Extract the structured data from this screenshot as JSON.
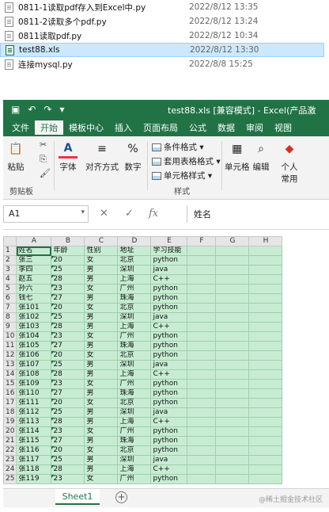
{
  "explorer": {
    "files": [
      {
        "name": "0811-1读取pdf存入到Excel中.py",
        "date": "2022/8/12 13:35",
        "icon": "py-file-icon",
        "selected": false
      },
      {
        "name": "0811-2读取多个pdf.py",
        "date": "2022/8/12 13:24",
        "icon": "py-file-icon",
        "selected": false
      },
      {
        "name": "0811读取pdf.py",
        "date": "2022/8/12 10:34",
        "icon": "py-file-icon",
        "selected": false
      },
      {
        "name": "test88.xls",
        "date": "2022/8/12 13:30",
        "icon": "xls-file-icon",
        "selected": true
      },
      {
        "name": "连接mysql.py",
        "date": "2022/8/8 15:25",
        "icon": "py-file-icon",
        "selected": false
      }
    ]
  },
  "excel": {
    "title": "test88.xls [兼容模式] - Excel(产品激",
    "colors": {
      "accent": "#217346",
      "cell_fill": "#c7ecd3"
    },
    "tabs": [
      "文件",
      "开始",
      "模板中心",
      "插入",
      "页面布局",
      "公式",
      "数据",
      "审阅",
      "视图"
    ],
    "active_tab": "开始",
    "ribbon": {
      "paste": "粘贴",
      "clipboard_group": "剪贴板",
      "font": "字体",
      "alignment": "对齐方式",
      "number": "数字",
      "conditional_format": "条件格式",
      "table_format": "套用表格格式",
      "cell_style": "单元格样式",
      "styles_group": "样式",
      "cells": "单元格",
      "editing": "编辑",
      "personal": "个人",
      "common": "常用",
      "number_symbol": "%",
      "font_symbol": "A"
    },
    "formula_bar": {
      "cell_ref": "A1",
      "fx": "fx",
      "cancel": "✕",
      "confirm": "✓",
      "content": "姓名"
    },
    "columns": [
      "A",
      "B",
      "C",
      "D",
      "E",
      "F",
      "G",
      "H"
    ],
    "header_row": [
      "姓名",
      "年龄",
      "性别",
      "地址",
      "学习技能"
    ],
    "rows": [
      [
        "张三",
        "20",
        "女",
        "北京",
        "python"
      ],
      [
        "李四",
        "25",
        "男",
        "深圳",
        "java"
      ],
      [
        "赵五",
        "28",
        "男",
        "上海",
        "C++"
      ],
      [
        "孙六",
        "23",
        "女",
        "广州",
        "python"
      ],
      [
        "钱七",
        "27",
        "男",
        "珠海",
        "python"
      ],
      [
        "张101",
        "20",
        "女",
        "北京",
        "python"
      ],
      [
        "张102",
        "25",
        "男",
        "深圳",
        "java"
      ],
      [
        "张103",
        "28",
        "男",
        "上海",
        "C++"
      ],
      [
        "张104",
        "23",
        "女",
        "广州",
        "python"
      ],
      [
        "张105",
        "27",
        "男",
        "珠海",
        "python"
      ],
      [
        "张106",
        "20",
        "女",
        "北京",
        "python"
      ],
      [
        "张107",
        "25",
        "男",
        "深圳",
        "java"
      ],
      [
        "张108",
        "28",
        "男",
        "上海",
        "C++"
      ],
      [
        "张109",
        "23",
        "女",
        "广州",
        "python"
      ],
      [
        "张110",
        "27",
        "男",
        "珠海",
        "python"
      ],
      [
        "张111",
        "20",
        "女",
        "北京",
        "python"
      ],
      [
        "张112",
        "25",
        "男",
        "深圳",
        "java"
      ],
      [
        "张113",
        "28",
        "男",
        "上海",
        "C++"
      ],
      [
        "张114",
        "23",
        "女",
        "广州",
        "python"
      ],
      [
        "张115",
        "27",
        "男",
        "珠海",
        "python"
      ],
      [
        "张116",
        "20",
        "女",
        "北京",
        "python"
      ],
      [
        "张117",
        "25",
        "男",
        "深圳",
        "java"
      ],
      [
        "张118",
        "28",
        "男",
        "上海",
        "C++"
      ],
      [
        "张119",
        "23",
        "女",
        "广州",
        "python"
      ]
    ],
    "sheet_tab": "Sheet1",
    "add_sheet": "+",
    "watermark": "@稀土掘金技术社区"
  }
}
